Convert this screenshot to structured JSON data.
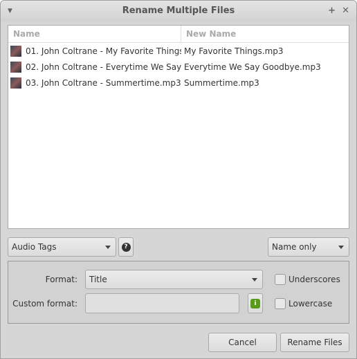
{
  "window": {
    "title": "Rename Multiple Files",
    "menu_icon": "triangle-down",
    "maximize_icon": "plus",
    "close_icon": "x"
  },
  "list": {
    "columns": [
      "Name",
      "New Name"
    ],
    "rows": [
      {
        "name": "01. John Coltrane - My Favorite Things....",
        "new_name": "My Favorite Things.mp3"
      },
      {
        "name": "02. John Coltrane - Everytime We Say ...",
        "new_name": "Everytime We Say Goodbye.mp3"
      },
      {
        "name": "03. John Coltrane - Summertime.mp3",
        "new_name": "Summertime.mp3"
      }
    ]
  },
  "controls": {
    "mode": "Audio Tags",
    "help_icon": "question-bubble",
    "scope": "Name only"
  },
  "panel": {
    "format_label": "Format:",
    "format_value": "Title",
    "custom_label": "Custom format:",
    "custom_value": "",
    "info_icon": "info-green",
    "underscores_label": "Underscores",
    "underscores_checked": false,
    "lowercase_label": "Lowercase",
    "lowercase_checked": false
  },
  "buttons": {
    "cancel": "Cancel",
    "rename": "Rename Files"
  }
}
